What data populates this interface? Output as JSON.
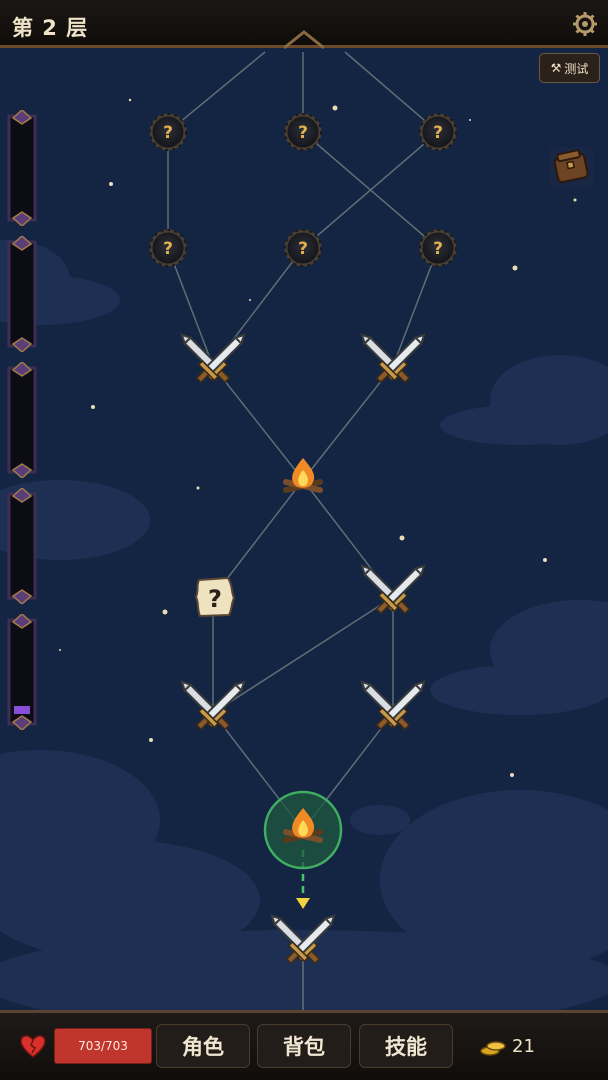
{
  "header": {
    "floor_label": "第 2 层"
  },
  "debug": {
    "test_label": "测试"
  },
  "map": {
    "node_types": [
      "mystery",
      "mystery",
      "mystery",
      "mystery",
      "mystery",
      "mystery",
      "battle",
      "battle",
      "campfire",
      "event",
      "battle",
      "battle",
      "battle",
      "campfire",
      "battle"
    ],
    "current_node": "campfire",
    "next_hint": "down-arrow"
  },
  "left_slots": {
    "count": 5,
    "last_slot_fill": 0.08,
    "fill_color": "#8a4fd8"
  },
  "footer": {
    "hp": "703/703",
    "buttons": {
      "character": "角色",
      "backpack": "背包",
      "skills": "技能"
    },
    "gold": "21"
  },
  "colors": {
    "sky": "#142544",
    "hp_bar": "#c0362d",
    "current_ring": "#3fae62",
    "path": "#7f8c8b"
  }
}
